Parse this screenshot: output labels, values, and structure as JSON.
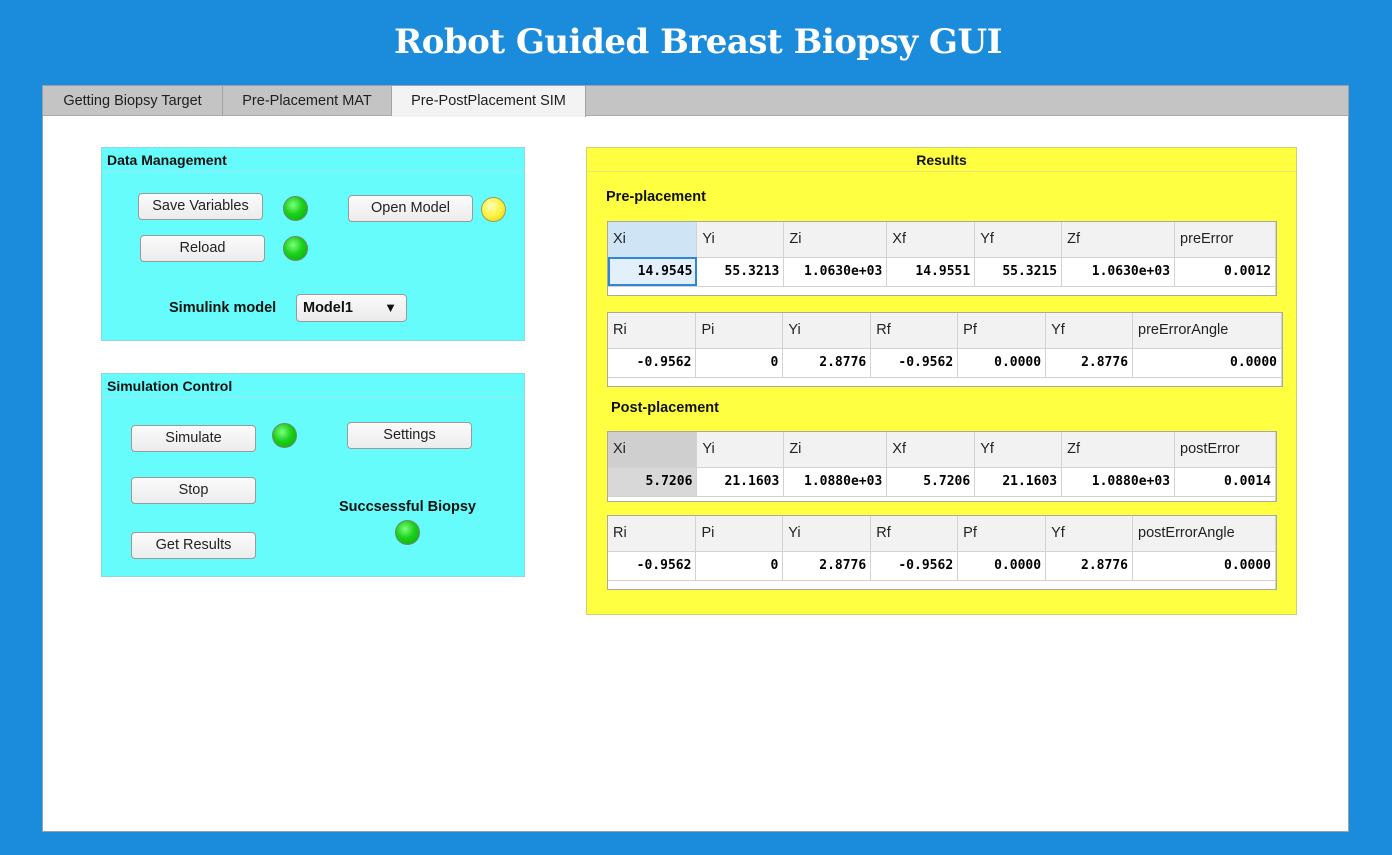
{
  "app_title": "Robot Guided Breast Biopsy GUI",
  "tabs": [
    {
      "label": "Getting Biopsy Target",
      "active": false
    },
    {
      "label": "Pre-Placement MAT",
      "active": false
    },
    {
      "label": "Pre-PostPlacement SIM",
      "active": true
    }
  ],
  "data_management": {
    "title": "Data Management",
    "save_variables_label": "Save Variables",
    "open_model_label": "Open Model",
    "reload_label": "Reload",
    "simulink_model_label": "Simulink model",
    "model_select_value": "Model1",
    "lamp_colors": {
      "save": "#1bd11b",
      "open_model": "#fff34a",
      "reload": "#1bd11b"
    }
  },
  "simulation_control": {
    "title": "Simulation Control",
    "simulate_label": "Simulate",
    "settings_label": "Settings",
    "stop_label": "Stop",
    "get_results_label": "Get Results",
    "successful_biopsy_label": "Succsessful Biopsy",
    "lamp_colors": {
      "simulate": "#1bd11b",
      "successful_biopsy": "#1bd11b"
    }
  },
  "results": {
    "title": "Results",
    "pre_placement_label": "Pre-placement",
    "post_placement_label": "Post-placement",
    "pre_position": {
      "headers": [
        "Xi",
        "Yi",
        "Zi",
        "Xf",
        "Yf",
        "Zf",
        "preError"
      ],
      "values": [
        "14.9545",
        "55.3213",
        "1.0630e+03",
        "14.9551",
        "55.3215",
        "1.0630e+03",
        "0.0012"
      ]
    },
    "pre_angle": {
      "headers": [
        "Ri",
        "Pi",
        "Yi",
        "Rf",
        "Pf",
        "Yf",
        "preErrorAngle"
      ],
      "values": [
        "-0.9562",
        "0",
        "2.8776",
        "-0.9562",
        "0.0000",
        "2.8776",
        "0.0000"
      ]
    },
    "post_position": {
      "headers": [
        "Xi",
        "Yi",
        "Zi",
        "Xf",
        "Yf",
        "Zf",
        "postError"
      ],
      "values": [
        "5.7206",
        "21.1603",
        "1.0880e+03",
        "5.7206",
        "21.1603",
        "1.0880e+03",
        "0.0014"
      ]
    },
    "post_angle": {
      "headers": [
        "Ri",
        "Pi",
        "Yi",
        "Rf",
        "Pf",
        "Yf",
        "postErrorAngle"
      ],
      "values": [
        "-0.9562",
        "0",
        "2.8776",
        "-0.9562",
        "0.0000",
        "2.8776",
        "0.0000"
      ]
    }
  },
  "colors": {
    "background": "#1b8bdc",
    "panel_cyan": "#66fcfc",
    "results_yellow": "#ffff42",
    "lamp_green": "#1bd11b",
    "lamp_yellow": "#fff34a"
  }
}
